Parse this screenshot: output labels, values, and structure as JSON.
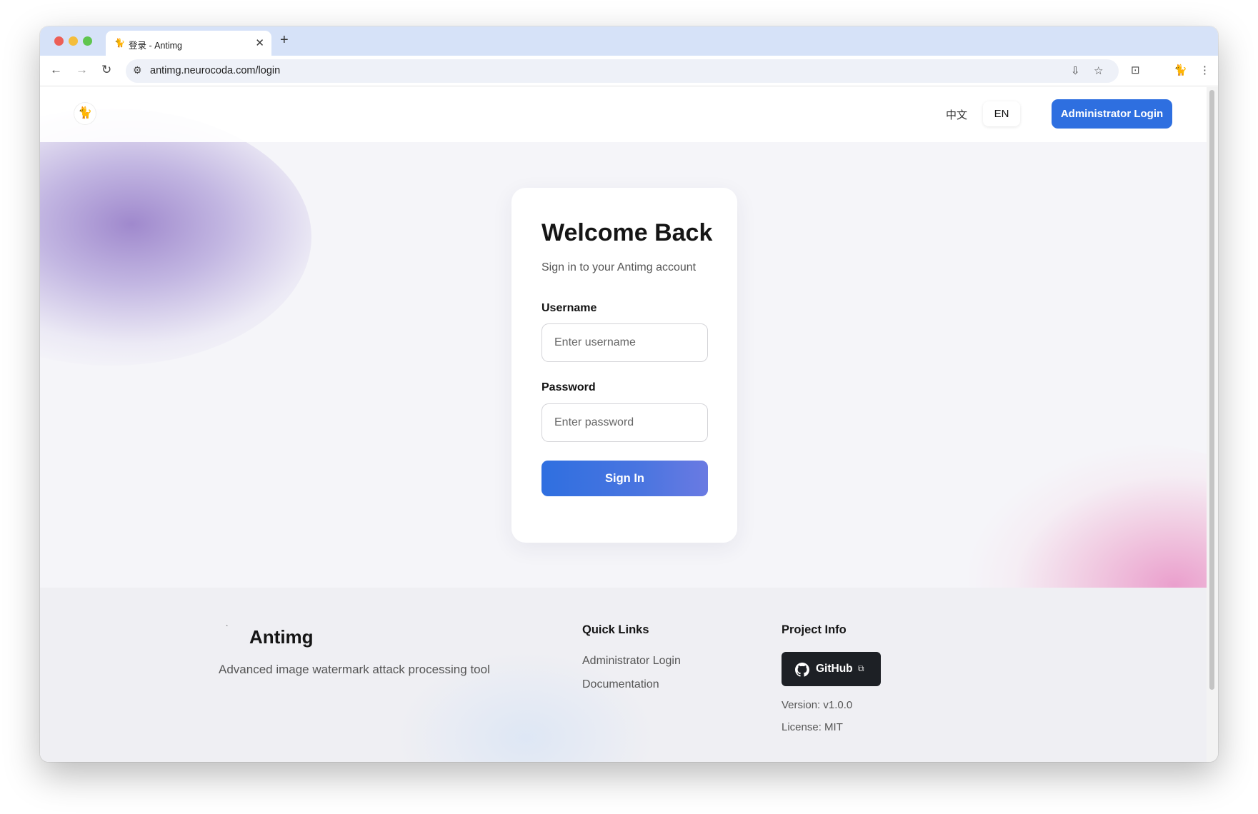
{
  "browser": {
    "tab_favicon": "🐈",
    "tab_title": "登录 - Antimg",
    "tab_close": "✕",
    "new_tab": "+",
    "url": "antimg.neurocoda.com/login",
    "icons": {
      "back": "←",
      "forward": "→",
      "reload": "↻",
      "site_settings": "⚙",
      "install": "⇩",
      "bookmark": "☆",
      "reading_mode": "⊡",
      "profile": "🐈",
      "menu": "⋮"
    }
  },
  "header": {
    "logo_glyph": "🐈",
    "lang_zh": "中文",
    "lang_en": "EN",
    "admin_button": "Administrator Login"
  },
  "login": {
    "title": "Welcome Back",
    "subtitle": "Sign in to your Antimg account",
    "username_label": "Username",
    "username_placeholder": "Enter username",
    "password_label": "Password",
    "password_placeholder": "Enter password",
    "submit": "Sign In"
  },
  "footer": {
    "brand_glyph": "`",
    "brand_name": "Antimg",
    "tagline": "Advanced image watermark attack processing tool",
    "quick_links_title": "Quick Links",
    "quick_links": [
      "Administrator Login",
      "Documentation"
    ],
    "project_info_title": "Project Info",
    "github_label": "GitHub",
    "github_ext_icon": "⧉",
    "version": "Version: v1.0.0",
    "license": "License: MIT"
  },
  "colors": {
    "primary": "#2e6fe0",
    "github_bg": "#1d2025",
    "tabstrip": "#d6e2f8"
  }
}
